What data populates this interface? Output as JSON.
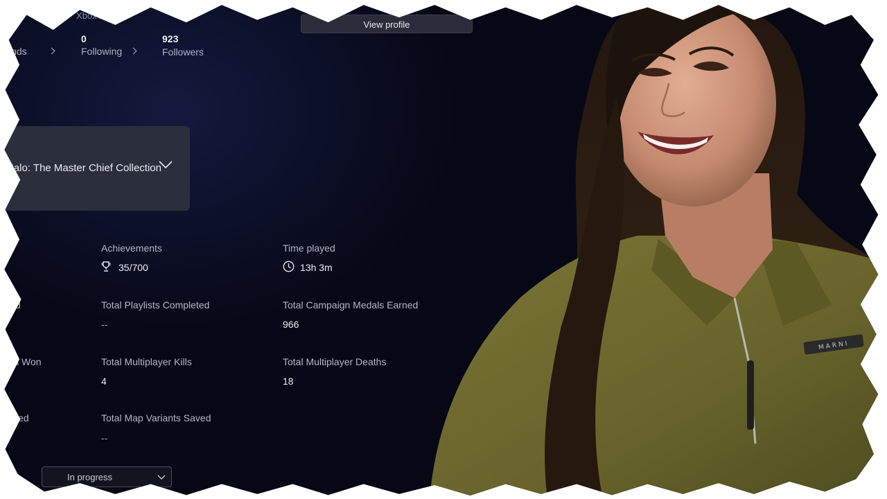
{
  "app": {
    "title": "Xbox App"
  },
  "header": {
    "view_profile_label": "View profile",
    "friends": {
      "label": "Friends"
    },
    "following": {
      "count": "0",
      "label": "Following"
    },
    "followers": {
      "count": "923",
      "label": "Followers"
    }
  },
  "game_selector": {
    "selected": "Halo: The Master Chief Collection"
  },
  "stats": {
    "achievements": {
      "label": "Achievements",
      "value": "35/700"
    },
    "time_played": {
      "label": "Time played",
      "value": "13h 3m"
    },
    "left_col_1": {
      "label": "Completed"
    },
    "playlists": {
      "label": "Total Playlists Completed",
      "value": "--"
    },
    "campaign_medals": {
      "label": "Total Campaign Medals Earned",
      "value": "966"
    },
    "left_col_2": {
      "label": "Games Won"
    },
    "mp_kills": {
      "label": "Total Multiplayer Kills",
      "value": "4"
    },
    "mp_deaths": {
      "label": "Total Multiplayer Deaths",
      "value": "18"
    },
    "left_col_3": {
      "label": "Saved"
    },
    "map_variants": {
      "label": "Total Map Variants Saved",
      "value": "--"
    }
  },
  "filter": {
    "selected": "In progress"
  },
  "photo": {
    "jacket_tag": "MARNI"
  },
  "colors": {
    "background": "#0a0c20",
    "card": "#2b2e3b",
    "jacket": "#6e6a30",
    "hair": "#1a120d",
    "skin": "#c99277"
  }
}
